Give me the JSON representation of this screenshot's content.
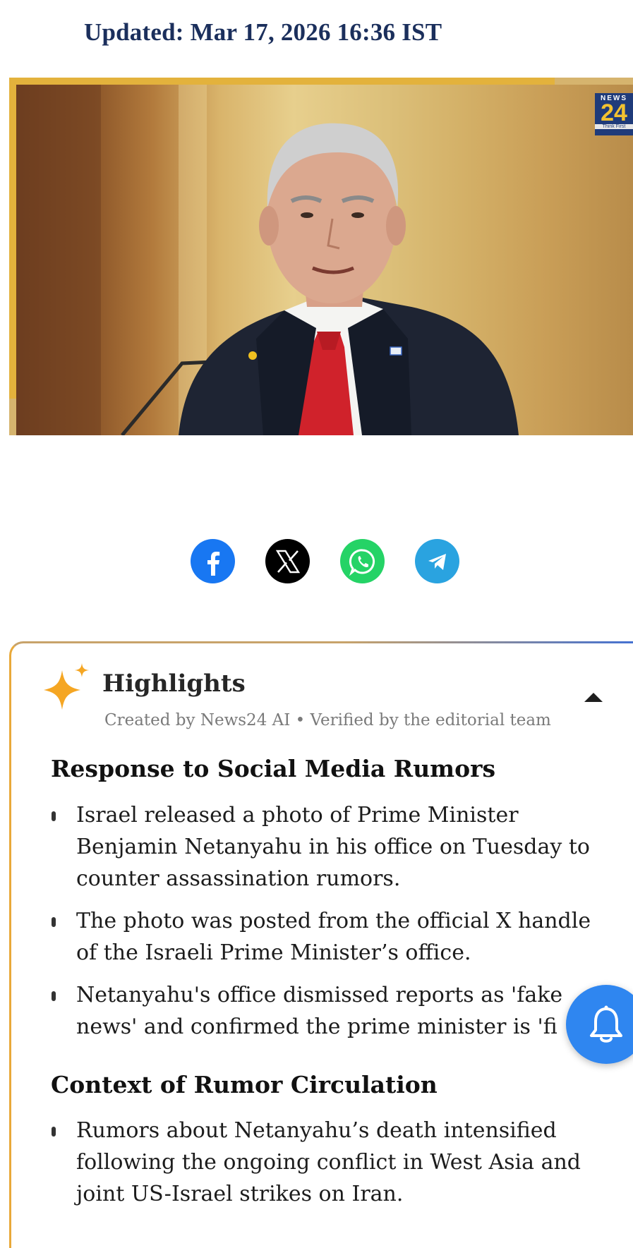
{
  "article": {
    "updated": "Updated: Mar 17, 2026 16:36 IST"
  },
  "hero": {
    "logo_top": "NEWS",
    "logo_number": "24",
    "logo_tagline": "Think First"
  },
  "share": [
    {
      "name": "facebook",
      "icon": "facebook-icon",
      "color": "#1877f2"
    },
    {
      "name": "x",
      "icon": "x-icon",
      "color": "#000000"
    },
    {
      "name": "whatsapp",
      "icon": "whatsapp-icon",
      "color": "#25d366"
    },
    {
      "name": "telegram",
      "icon": "telegram-icon",
      "color": "#2aa3e0"
    }
  ],
  "highlights": {
    "title": "Highlights",
    "created_by": "Created by News24 AI • Verified by the editorial team",
    "sections": [
      {
        "heading": "Response to Social Media Rumors",
        "bullets": [
          "Israel released a photo of Prime Minister Benjamin Netanyahu in his office on Tuesday to counter assassination rumors.",
          "The photo was posted from the official X handle of the Israeli Prime Minister’s office.",
          "Netanyahu's office dismissed reports as 'fake news' and confirmed the prime minister is 'fi"
        ]
      },
      {
        "heading": "Context of Rumor Circulation",
        "bullets": [
          "Rumors about Netanyahu’s death intensified following the ongoing conflict in West Asia and joint US-Israel strikes on Iran."
        ]
      }
    ]
  },
  "colors": {
    "accent_gold": "#e3b23c",
    "navy": "#1b2f5c",
    "bell_blue": "#2f86f0"
  }
}
